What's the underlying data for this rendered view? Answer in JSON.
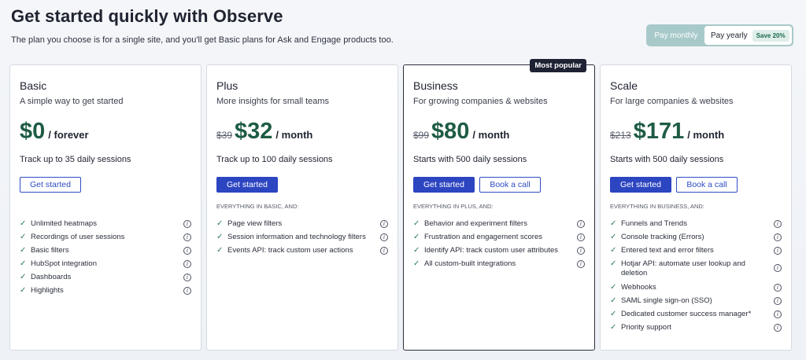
{
  "header": {
    "title": "Get started quickly with Observe",
    "subtitle": "The plan you choose is for a single site, and you'll get Basic plans for Ask and Engage products too."
  },
  "billing": {
    "monthly_label": "Pay monthly",
    "yearly_label": "Pay yearly",
    "save_badge": "Save 20%"
  },
  "plans": [
    {
      "name": "Basic",
      "desc": "A simple way to get started",
      "old_price": "",
      "price": "$0",
      "period": "/ forever",
      "sessions": "Track up to 35 daily sessions",
      "primary_btn": "Get started",
      "secondary_btn": "",
      "features_label": "",
      "features": [
        "Unlimited heatmaps",
        "Recordings of user sessions",
        "Basic filters",
        "HubSpot integration",
        "Dashboards",
        "Highlights"
      ]
    },
    {
      "name": "Plus",
      "desc": "More insights for small teams",
      "old_price": "$39",
      "price": "$32",
      "period": "/ month",
      "sessions": "Track up to 100 daily sessions",
      "primary_btn": "Get started",
      "secondary_btn": "",
      "features_label": "EVERYTHING IN BASIC, AND:",
      "features": [
        "Page view filters",
        "Session information and technology filters",
        "Events API: track custom user actions"
      ]
    },
    {
      "name": "Business",
      "desc": "For growing companies & websites",
      "old_price": "$99",
      "price": "$80",
      "period": "/ month",
      "sessions": "Starts with 500 daily sessions",
      "primary_btn": "Get started",
      "secondary_btn": "Book a call",
      "popular_tag": "Most popular",
      "features_label": "EVERYTHING IN PLUS, AND:",
      "features": [
        "Behavior and experiment filters",
        "Frustration and engagement scores",
        "Identify API: track custom user attributes",
        "All custom-built integrations"
      ]
    },
    {
      "name": "Scale",
      "desc": "For large companies & websites",
      "old_price": "$213",
      "price": "$171",
      "period": "/ month",
      "sessions": "Starts with 500 daily sessions",
      "primary_btn": "Get started",
      "secondary_btn": "Book a call",
      "features_label": "EVERYTHING IN BUSINESS, AND:",
      "features": [
        "Funnels and Trends",
        "Console tracking (Errors)",
        "Entered text and error filters",
        "Hotjar API: automate user lookup and deletion",
        "Webhooks",
        "SAML single sign-on (SSO)",
        "Dedicated customer success manager*",
        "Priority support"
      ]
    }
  ],
  "icons": {
    "check": "check-icon",
    "info": "info-icon"
  },
  "colors": {
    "price_green": "#1e5c44",
    "button_blue": "#2c45c0",
    "toggle_bg": "#a8c9c9"
  }
}
